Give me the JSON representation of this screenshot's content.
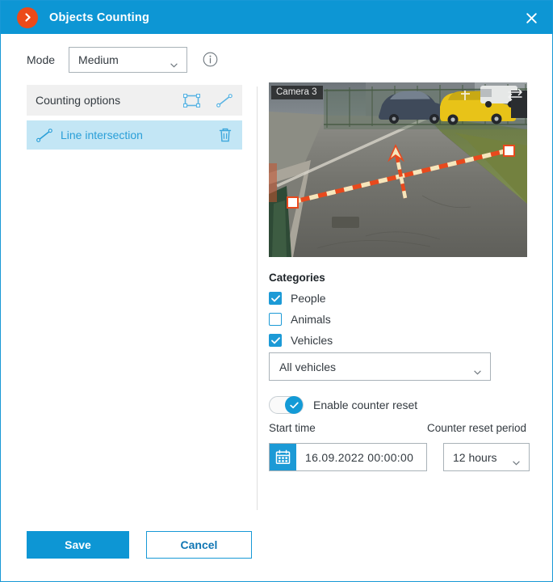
{
  "window": {
    "title": "Objects Counting",
    "logo_icon": "chevron-right-circle-icon",
    "close_icon": "close-icon",
    "accent_color": "#0d96d4",
    "logo_color": "#ec4a19"
  },
  "mode": {
    "label": "Mode",
    "value": "Medium",
    "info_icon": "info-icon",
    "caret_icon": "chevron-down-icon"
  },
  "counting_options": {
    "header": "Counting options",
    "rect_tool_icon": "rectangle-tool-icon",
    "line_tool_icon": "line-tool-icon",
    "shapes": [
      {
        "label": "Line intersection",
        "icon": "line-tool-icon",
        "delete_icon": "trash-icon",
        "selected": true
      }
    ]
  },
  "preview": {
    "camera_label": "Camera 3",
    "direction_icon": "swap-direction-icon",
    "line_color": "#e8491d",
    "line_dash_color": "#f5e6bc"
  },
  "categories": {
    "title": "Categories",
    "items": [
      {
        "label": "People",
        "checked": true
      },
      {
        "label": "Animals",
        "checked": false
      },
      {
        "label": "Vehicles",
        "checked": true
      }
    ],
    "vehicle_type": {
      "value": "All vehicles",
      "caret_icon": "chevron-down-icon"
    }
  },
  "counter_reset": {
    "toggle_label": "Enable counter reset",
    "toggle_on": true,
    "toggle_check_icon": "check-icon",
    "start_time_label": "Start time",
    "period_label": "Counter reset period",
    "calendar_icon": "calendar-icon",
    "datetime_value": "16.09.2022   00:00:00",
    "period_value": "12 hours",
    "caret_icon": "chevron-down-icon"
  },
  "footer": {
    "save_label": "Save",
    "cancel_label": "Cancel"
  }
}
